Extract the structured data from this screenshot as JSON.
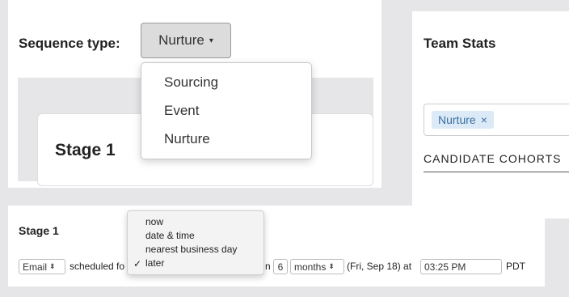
{
  "sequence": {
    "label": "Sequence type:",
    "selected": "Nurture",
    "caret": "▾",
    "menu_items": [
      "Sourcing",
      "Event",
      "Nurture"
    ]
  },
  "stage_card": {
    "title": "Stage 1"
  },
  "team_stats": {
    "title": "Team Stats",
    "tag": "Nurture",
    "tag_remove": "×",
    "cohorts_label": "CANDIDATE COHORTS"
  },
  "stage_row": {
    "title": "Stage 1",
    "channel": "Email",
    "scheduled_text": "scheduled fo",
    "partial_text": "n",
    "amount": "6",
    "unit": "months",
    "date_text": "(Fri, Sep 18) at",
    "time": "03:25 PM",
    "tz": "PDT"
  },
  "timing_menu": {
    "items": [
      "now",
      "date & time",
      "nearest business day",
      "later"
    ],
    "check": "✓"
  },
  "icons": {
    "spinner": "updown-spinner-icon"
  }
}
